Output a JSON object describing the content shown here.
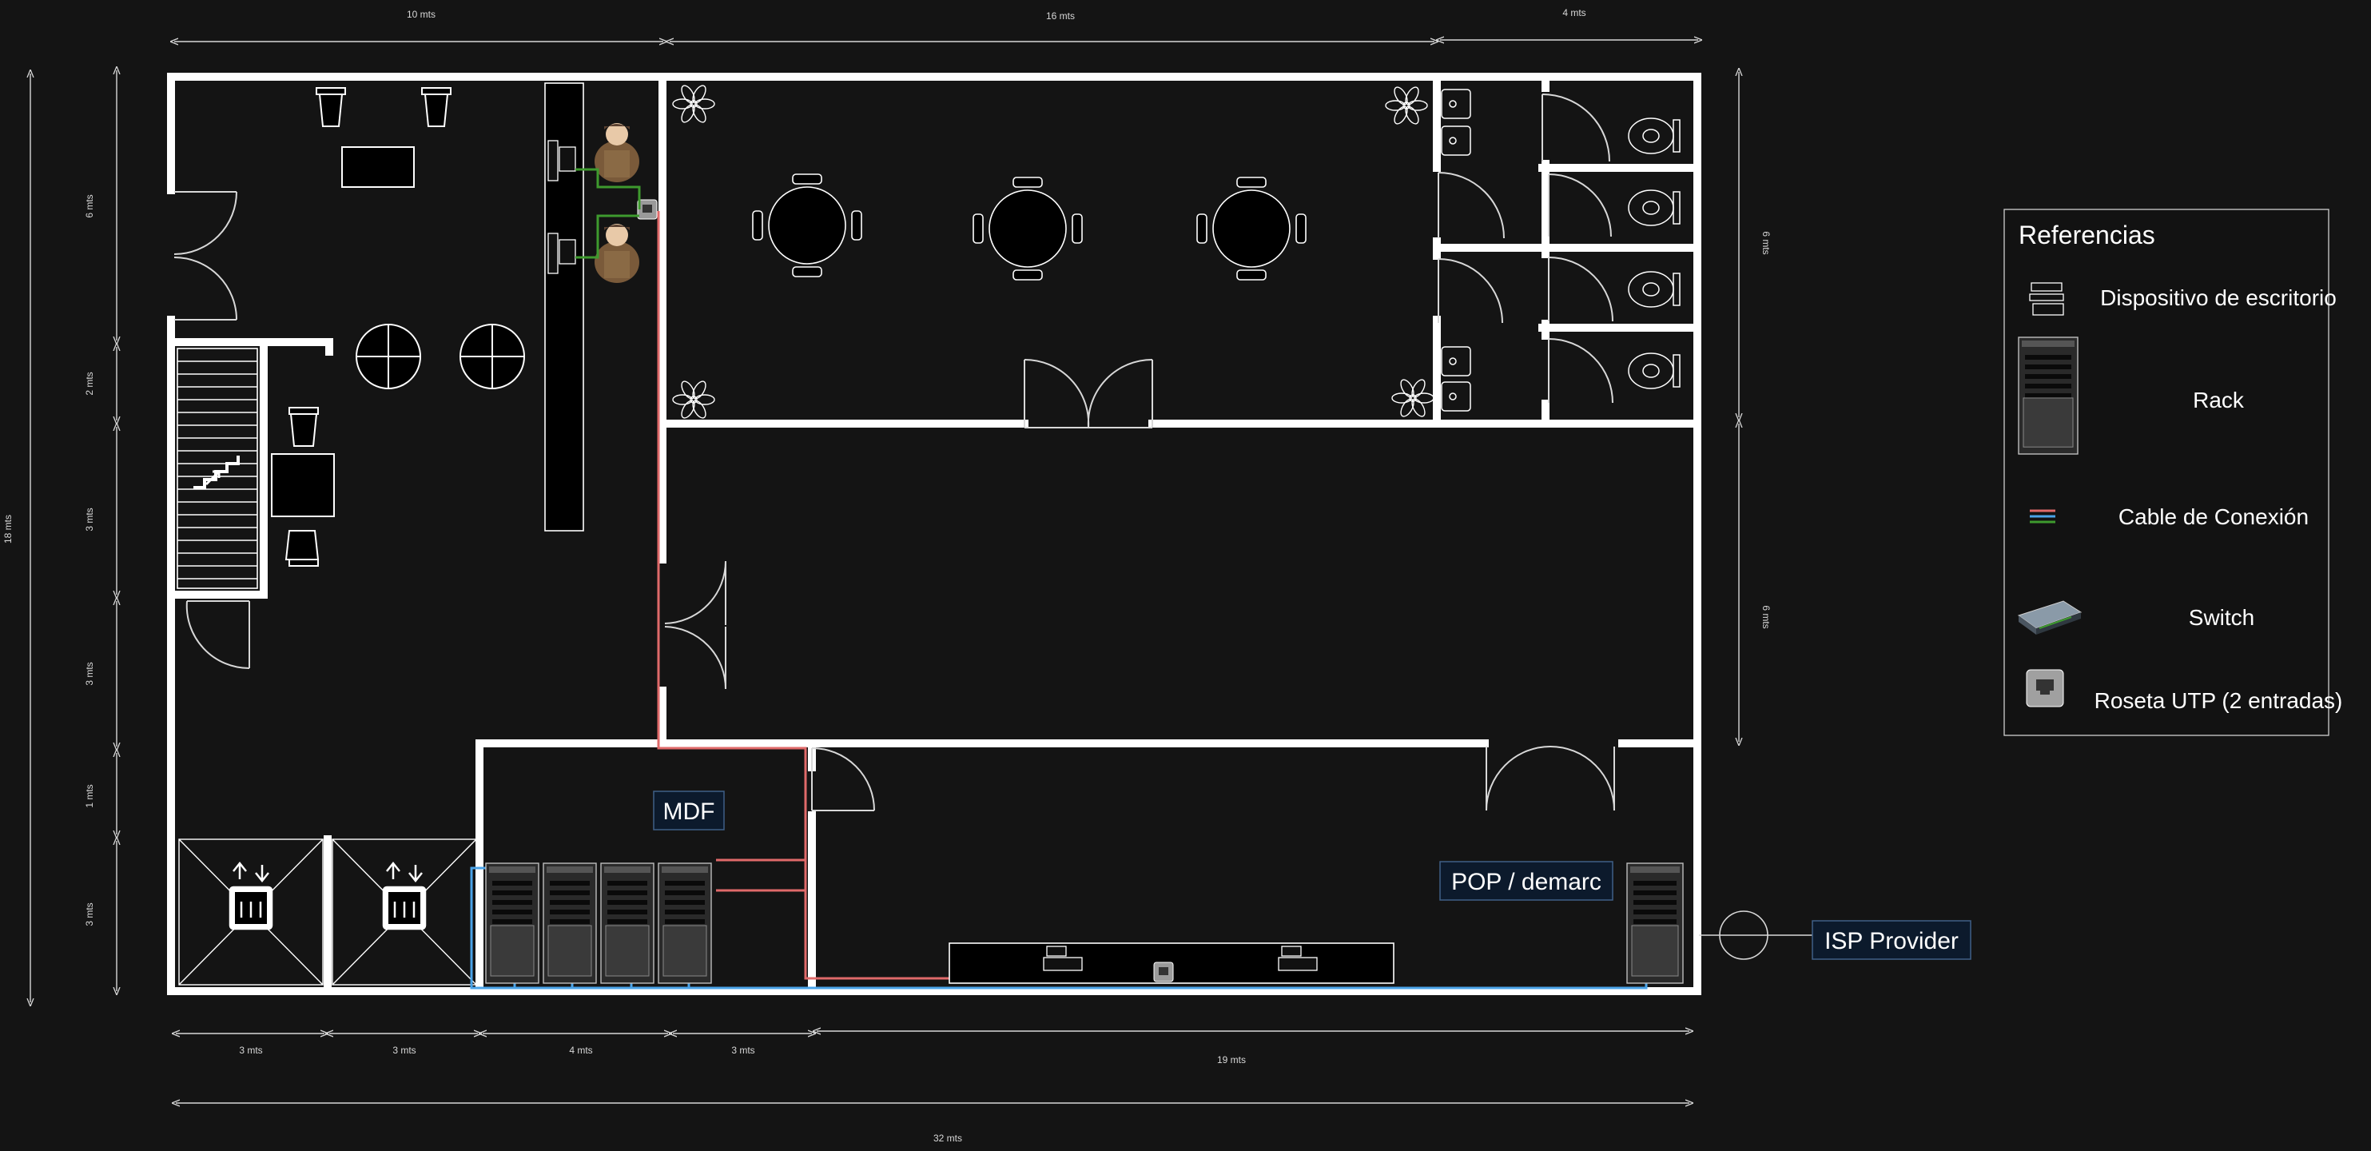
{
  "dimensions": {
    "top_left": "10 mts",
    "top_mid": "16 mts",
    "top_right": "4 mts",
    "left_total": "18 mts",
    "left_seg1": "6 mts",
    "left_seg2": "2 mts",
    "left_seg3": "3 mts",
    "left_seg4": "3 mts",
    "left_seg5": "1 mts",
    "left_seg6": "3 mts",
    "right_top": "6 mts",
    "right_bottom": "6 mts",
    "bottom_seg1": "3 mts",
    "bottom_seg2": "3 mts",
    "bottom_seg3": "4 mts",
    "bottom_seg4": "3 mts",
    "bottom_seg5": "19 mts",
    "bottom_total": "32 mts"
  },
  "labels": {
    "mdf": "MDF",
    "pop": "POP / demarc",
    "isp": "ISP Provider"
  },
  "legend": {
    "title": "Referencias",
    "items": [
      {
        "icon": "desktop-device-icon",
        "label": "Dispositivo de escritorio"
      },
      {
        "icon": "rack-icon",
        "label": "Rack"
      },
      {
        "icon": "cable-icon",
        "label": "Cable de Conexión"
      },
      {
        "icon": "switch-icon",
        "label": "Switch"
      },
      {
        "icon": "utp-outlet-icon",
        "label": "Roseta UTP (2 entradas)"
      }
    ]
  },
  "colors": {
    "background": "#141414",
    "wall": "#ffffff",
    "cable_red": "#e06a6a",
    "cable_blue": "#4aa3e8",
    "cable_green": "#3e9a2e",
    "label_box": "#0c1a2c"
  }
}
